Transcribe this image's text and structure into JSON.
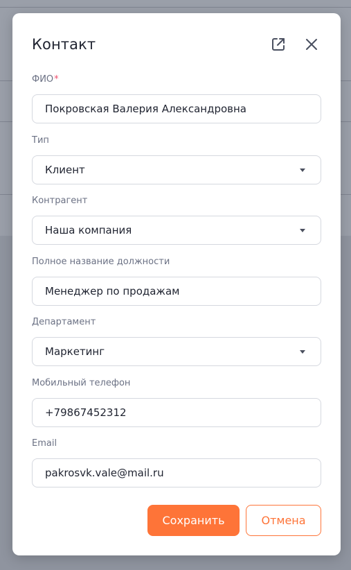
{
  "modal": {
    "title": "Контакт",
    "open_external_icon": "external-link-icon",
    "close_icon": "close-icon"
  },
  "fields": {
    "fio": {
      "label": "ФИО",
      "required_mark": "*",
      "value": "Покровская Валерия Александровна"
    },
    "type": {
      "label": "Тип",
      "value": "Клиент"
    },
    "counterparty": {
      "label": "Контрагент",
      "value": "Наша компания"
    },
    "position": {
      "label": "Полное название должности",
      "value": "Менеджер по продажам"
    },
    "department": {
      "label": "Департамент",
      "value": "Маркетинг"
    },
    "mobile": {
      "label": "Мобильный телефон",
      "value": "+79867452312"
    },
    "email": {
      "label": "Email",
      "value": "pakrosvk.vale@mail.ru"
    }
  },
  "footer": {
    "save_label": "Сохранить",
    "cancel_label": "Отмена"
  },
  "colors": {
    "accent": "#fe7438",
    "required": "#f0506e",
    "overlay": "#8e939e"
  }
}
